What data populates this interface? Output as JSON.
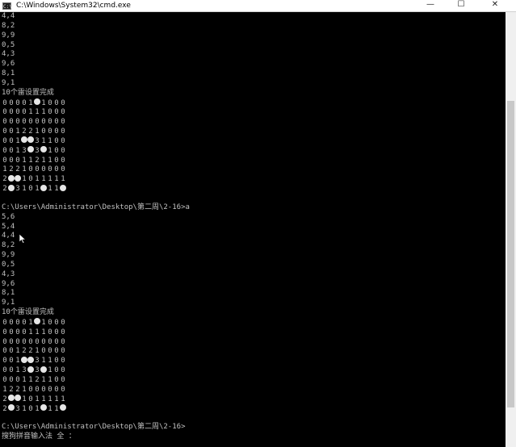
{
  "window": {
    "title": "C:\\Windows\\System32\\cmd.exe",
    "icon_label": "C:\\",
    "controls": {
      "minimize": "—",
      "maximize": "☐",
      "close": "✕"
    }
  },
  "console": {
    "block1_prelude": [
      "4,4",
      "8,2",
      "9,9",
      "0,5",
      "4,3",
      "9,6",
      "8,1",
      "9,1"
    ],
    "done1": "10个雷设置完成",
    "grid1": [
      [
        "0",
        "0",
        "0",
        "0",
        "1",
        "●",
        "1",
        "0",
        "0",
        "0"
      ],
      [
        "0",
        "0",
        "0",
        "0",
        "1",
        "1",
        "1",
        "0",
        "0",
        "0"
      ],
      [
        "0",
        "0",
        "0",
        "0",
        "0",
        "0",
        "0",
        "0",
        "0",
        "0"
      ],
      [
        "0",
        "0",
        "1",
        "2",
        "2",
        "1",
        "0",
        "0",
        "0",
        "0"
      ],
      [
        "0",
        "0",
        "1",
        "●",
        "●",
        "3",
        "1",
        "1",
        "0",
        "0"
      ],
      [
        "0",
        "0",
        "1",
        "3",
        "●",
        "3",
        "●",
        "1",
        "0",
        "0"
      ],
      [
        "0",
        "0",
        "0",
        "1",
        "1",
        "2",
        "1",
        "1",
        "0",
        "0"
      ],
      [
        "1",
        "2",
        "2",
        "1",
        "0",
        "0",
        "0",
        "0",
        "0",
        "0"
      ],
      [
        "2",
        "●",
        "●",
        "1",
        "0",
        "1",
        "1",
        "1",
        "1",
        "1"
      ],
      [
        "2",
        "●",
        "3",
        "1",
        "0",
        "1",
        "●",
        "1",
        "1",
        "●"
      ]
    ],
    "prompt1": "C:\\Users\\Administrator\\Desktop\\第二周\\2-16>a",
    "block2_prelude": [
      "5,6",
      "5,4",
      "4,4",
      "8,2",
      "9,9",
      "0,5",
      "4,3",
      "9,6",
      "8,1",
      "9,1"
    ],
    "done2": "10个雷设置完成",
    "grid2": [
      [
        "0",
        "0",
        "0",
        "0",
        "1",
        "●",
        "1",
        "0",
        "0",
        "0"
      ],
      [
        "0",
        "0",
        "0",
        "0",
        "1",
        "1",
        "1",
        "0",
        "0",
        "0"
      ],
      [
        "0",
        "0",
        "0",
        "0",
        "0",
        "0",
        "0",
        "0",
        "0",
        "0"
      ],
      [
        "0",
        "0",
        "1",
        "2",
        "2",
        "1",
        "0",
        "0",
        "0",
        "0"
      ],
      [
        "0",
        "0",
        "1",
        "●",
        "●",
        "3",
        "1",
        "1",
        "0",
        "0"
      ],
      [
        "0",
        "0",
        "1",
        "3",
        "●",
        "3",
        "●",
        "1",
        "0",
        "0"
      ],
      [
        "0",
        "0",
        "0",
        "1",
        "1",
        "2",
        "1",
        "1",
        "0",
        "0"
      ],
      [
        "1",
        "2",
        "2",
        "1",
        "0",
        "0",
        "0",
        "0",
        "0",
        "0"
      ],
      [
        "2",
        "●",
        "●",
        "1",
        "0",
        "1",
        "1",
        "1",
        "1",
        "1"
      ],
      [
        "2",
        "●",
        "3",
        "1",
        "0",
        "1",
        "●",
        "1",
        "1",
        "●"
      ]
    ],
    "prompt2": "C:\\Users\\Administrator\\Desktop\\第二周\\2-16>",
    "ime_status": "搜狗拼音输入法 全 ："
  },
  "colors": {
    "console_bg": "#000000",
    "console_fg": "#c0c0c0",
    "mine": "#e6e6e6"
  }
}
